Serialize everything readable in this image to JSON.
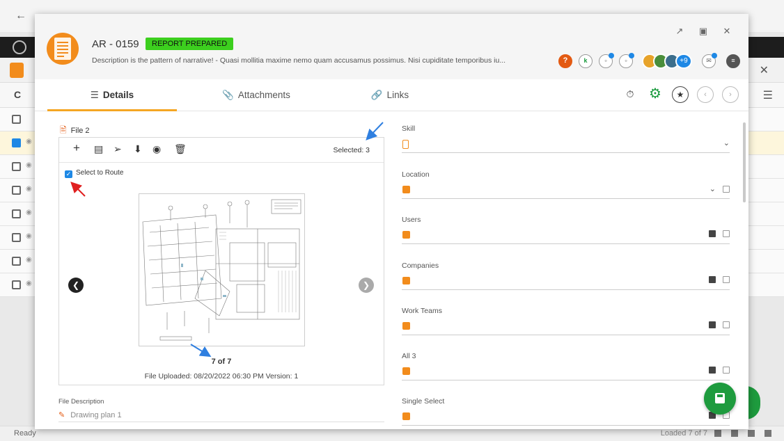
{
  "background": {
    "status_ready": "Ready",
    "status_loaded": "Loaded 7 of 7",
    "list_rows": [
      {
        "selected": false
      },
      {
        "selected": true
      },
      {
        "selected": false
      },
      {
        "selected": false
      },
      {
        "selected": false
      },
      {
        "selected": false
      },
      {
        "selected": false
      }
    ]
  },
  "header": {
    "title": "AR - 0159",
    "status_badge": "REPORT PREPARED",
    "description": "Description is the pattern of narrative!  - Quasi mollitia maxime nemo quam accusamus possimus. Nisi cupiditate temporibus iu...",
    "more_assignees": "+9"
  },
  "tabs": [
    {
      "label": "Details",
      "icon": "list-icon"
    },
    {
      "label": "Attachments",
      "icon": "paperclip-icon"
    },
    {
      "label": "Links",
      "icon": "link-icon"
    }
  ],
  "file_viewer": {
    "file_label": "File 2",
    "selected_count": "Selected: 3",
    "route_label": "Select to Route",
    "route_checked": true,
    "pager": "7 of 7",
    "uploaded": "File Uploaded: 08/20/2022  06:30 PM  Version: 1"
  },
  "file_description": {
    "label": "File Description",
    "value": "Drawing plan 1"
  },
  "fields": [
    {
      "label": "Skill",
      "value": ""
    },
    {
      "label": "Location",
      "value": ""
    },
    {
      "label": "Users",
      "value": ""
    },
    {
      "label": "Companies",
      "value": ""
    },
    {
      "label": "Work Teams",
      "value": ""
    },
    {
      "label": "All 3",
      "value": ""
    },
    {
      "label": "Single Select",
      "value": ""
    }
  ],
  "colors": {
    "accent": "#f28c1c",
    "badge": "#3ccf1e",
    "save": "#1e9b3e",
    "annotation_blue": "#2f7fe0",
    "annotation_red": "#e02020"
  }
}
